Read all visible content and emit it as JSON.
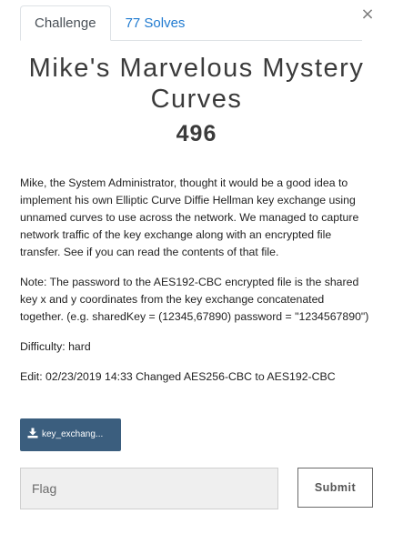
{
  "header": {
    "close_symbol": "×",
    "tabs": [
      {
        "label": "Challenge",
        "active": true
      },
      {
        "label": "77 Solves",
        "active": false
      }
    ]
  },
  "challenge": {
    "name": "Mike's Marvelous Mystery Curves",
    "value": "496",
    "description": [
      "Mike, the System Administrator, thought it would be a good idea to implement his own Elliptic Curve Diffie Hellman key exchange using unnamed curves to use across the network. We managed to capture network traffic of the key exchange along with an encrypted file transfer. See if you can read the contents of that file.",
      "Note: The password to the AES192-CBC encrypted file is the shared key x and y coordinates from the key exchange concatenated together. (e.g. sharedKey = (12345,67890) password = \"1234567890\")",
      "Difficulty: hard",
      "Edit: 02/23/2019 14:33 Changed AES256-CBC to AES192-CBC"
    ],
    "file_label": "key_exchang..."
  },
  "submission": {
    "placeholder": "Flag",
    "value": "",
    "submit_label": "Submit"
  },
  "colors": {
    "tab_link": "#1f7ad0",
    "file_button": "#3b5e7e",
    "input_background": "#efefef"
  },
  "icons": {
    "close": "close-icon",
    "file": "download-icon"
  }
}
